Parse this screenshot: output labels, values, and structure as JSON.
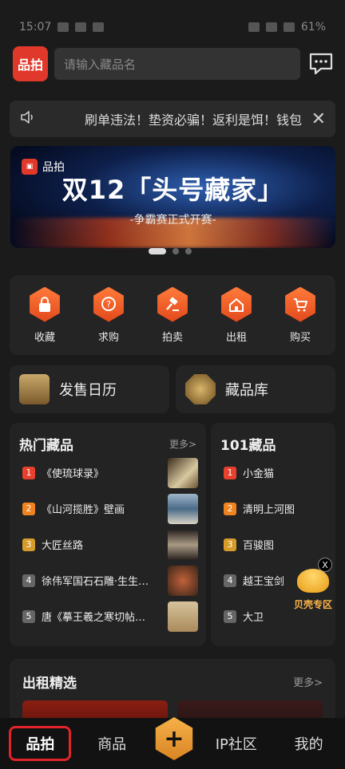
{
  "status": {
    "time": "15:07",
    "battery": "61%"
  },
  "header": {
    "logo": "品拍",
    "search_placeholder": "请输入藏品名"
  },
  "notice": {
    "text": "刷单违法！垫资必骗！返利是饵！钱包"
  },
  "banner": {
    "brand": "品拍",
    "headline": "双12「头号藏家」",
    "subheadline": "-争霸赛正式开赛-"
  },
  "quick": [
    {
      "label": "收藏",
      "icon": "lock-icon"
    },
    {
      "label": "求购",
      "icon": "question-bubble-icon"
    },
    {
      "label": "拍卖",
      "icon": "gavel-icon"
    },
    {
      "label": "出租",
      "icon": "house-icon"
    },
    {
      "label": "购买",
      "icon": "cart-icon"
    }
  ],
  "cards": [
    {
      "label": "发售日历",
      "icon": "calendar-icon"
    },
    {
      "label": "藏品库",
      "icon": "collection-icon"
    }
  ],
  "hot": {
    "title": "热门藏品",
    "more": "更多>",
    "items": [
      {
        "rank": "1",
        "name": "《使琉球录》"
      },
      {
        "rank": "2",
        "name": "《山河揽胜》壁画"
      },
      {
        "rank": "3",
        "name": "大匠丝路"
      },
      {
        "rank": "4",
        "name": "徐伟军国石石雕·生生…"
      },
      {
        "rank": "5",
        "name": "唐《摹王羲之寒切帖…"
      }
    ]
  },
  "top101": {
    "title": "101藏品",
    "items": [
      {
        "rank": "1",
        "name": "小金猫"
      },
      {
        "rank": "2",
        "name": "清明上河图"
      },
      {
        "rank": "3",
        "name": "百骏图"
      },
      {
        "rank": "4",
        "name": "越王宝剑"
      },
      {
        "rank": "5",
        "name": "大卫"
      }
    ]
  },
  "float": {
    "label": "贝壳专区",
    "close": "X"
  },
  "rental": {
    "title": "出租精选",
    "more": "更多>"
  },
  "tabs": {
    "home": "品拍",
    "goods": "商品",
    "plus": "+",
    "community": "IP社区",
    "mine": "我的"
  },
  "colors": {
    "accent": "#e0382a",
    "orange": "#f0831f",
    "background": "#1b1b1b"
  }
}
